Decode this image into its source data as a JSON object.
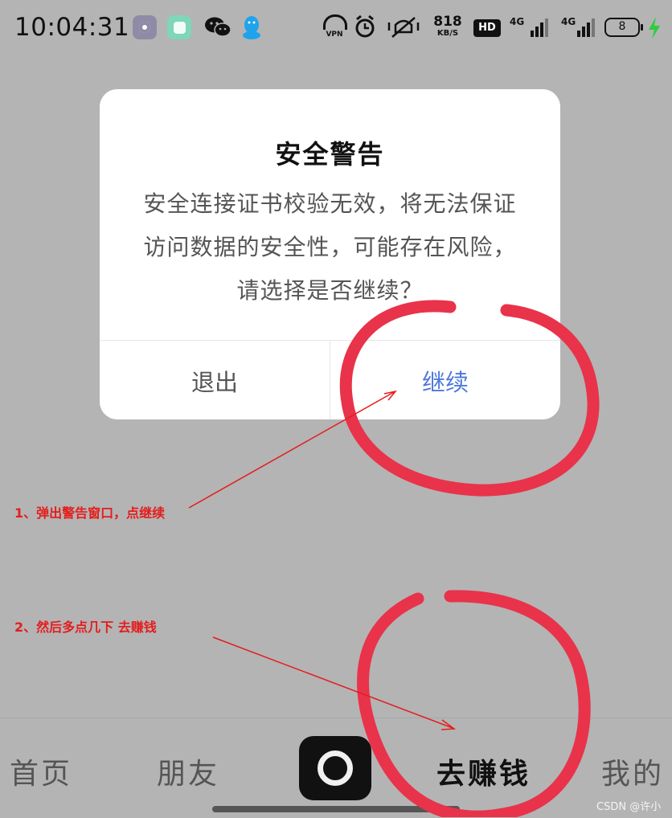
{
  "status_bar": {
    "time": "10:04:31",
    "vpn_label": "VPN",
    "net_speed_value": "818",
    "net_speed_unit": "KB/S",
    "hd_label": "HD",
    "sim1_label": "4G",
    "sim2_label": "4G",
    "battery_level": "8",
    "icons": [
      "settings-app-icon",
      "square-app-icon",
      "wechat-icon",
      "qq-icon",
      "vpn-icon",
      "alarm-icon",
      "mute-icon",
      "hd-icon",
      "signal-icon",
      "signal-icon",
      "battery-icon",
      "charging-icon"
    ]
  },
  "dialog": {
    "title": "安全警告",
    "message": "安全连接证书校验无效，将无法保证访问数据的安全性，可能存在风险，请选择是否继续？",
    "exit_label": "退出",
    "continue_label": "继续",
    "continue_color": "#4f78d8"
  },
  "annotations": {
    "step1": "1、弹出警告窗口，点继续",
    "step2": "2、然后多点几下 去赚钱",
    "color": "#e41d1d",
    "circle_color": "#e8334a"
  },
  "bottom_nav": {
    "items": [
      {
        "label": "首页"
      },
      {
        "label": "朋友"
      },
      {
        "label": "去赚钱"
      },
      {
        "label": "我的"
      }
    ],
    "center_icon": "camera-icon"
  },
  "watermark": "CSDN @许小"
}
